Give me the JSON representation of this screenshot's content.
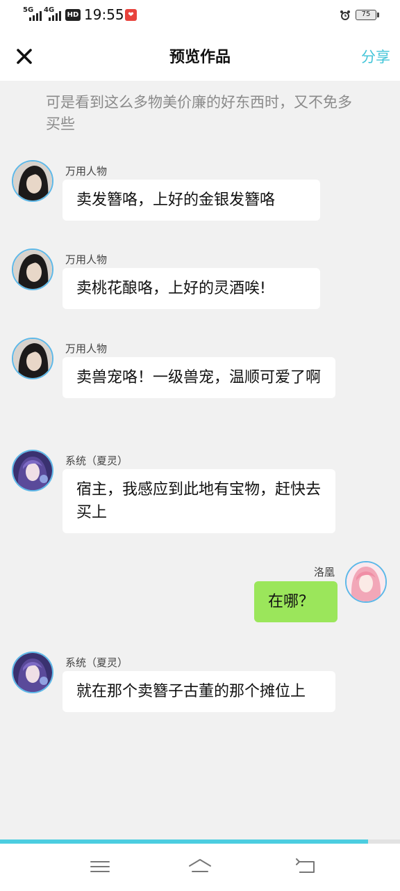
{
  "status_bar": {
    "net1": "5G",
    "net2": "4G",
    "hd": "HD",
    "time": "19:55",
    "battery": "75"
  },
  "nav": {
    "close_icon": "close-icon",
    "title": "预览作品",
    "share": "分享"
  },
  "narration": "可是看到这么多物美价廉的好东西时，又不免多买些",
  "messages": [
    {
      "sender": "万用人物",
      "text": "卖发簪咯，上好的金银发簪咯",
      "side": "left"
    },
    {
      "sender": "万用人物",
      "text": "卖桃花酿咯，上好的灵酒唉!",
      "side": "left"
    },
    {
      "sender": "万用人物",
      "text": "卖兽宠咯！一级兽宠，温顺可爱了啊",
      "side": "left"
    },
    {
      "sender": "系统（夏灵）",
      "text": "宿主，我感应到此地有宝物，赶快去买上",
      "side": "left"
    },
    {
      "sender": "洛凰",
      "text": "在哪？",
      "side": "right"
    },
    {
      "sender": "系统（夏灵）",
      "text": "就在那个卖簪子古董的那个摊位上",
      "side": "left"
    }
  ],
  "progress": 0.92,
  "colors": {
    "accent": "#44c5d8",
    "self_bubble": "#9be65b",
    "avatar_border": "#5db8e8"
  }
}
